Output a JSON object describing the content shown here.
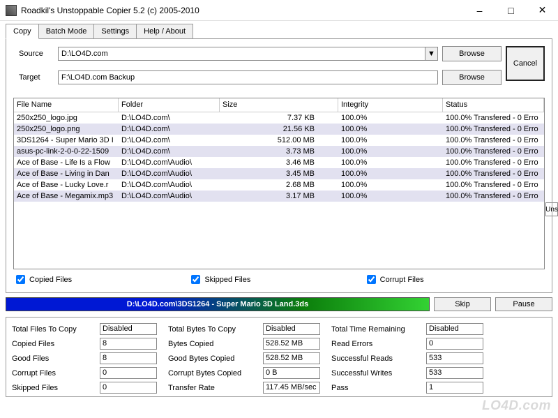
{
  "window": {
    "title": "Roadkil's Unstoppable Copier 5.2 (c) 2005-2010"
  },
  "tabs": [
    "Copy",
    "Batch Mode",
    "Settings",
    "Help / About"
  ],
  "active_tab": 0,
  "paths": {
    "source_label": "Source",
    "source_value": "D:\\LO4D.com",
    "target_label": "Target",
    "target_value": "F:\\LO4D.com Backup",
    "browse_label": "Browse",
    "cancel_label": "Cancel"
  },
  "columns": {
    "file_name": "File Name",
    "folder": "Folder",
    "size": "Size",
    "integrity": "Integrity",
    "status": "Status"
  },
  "rows": [
    {
      "name": "250x250_logo.jpg",
      "folder": "D:\\LO4D.com\\",
      "size": "7.37 KB",
      "integ": "100.0%",
      "status": "100.0% Transfered - 0 Erro",
      "sel": false
    },
    {
      "name": "250x250_logo.png",
      "folder": "D:\\LO4D.com\\",
      "size": "21.56 KB",
      "integ": "100.0%",
      "status": "100.0% Transfered - 0 Erro",
      "sel": true
    },
    {
      "name": "3DS1264 - Super Mario 3D I",
      "folder": "D:\\LO4D.com\\",
      "size": "512.00 MB",
      "integ": "100.0%",
      "status": "100.0% Transfered - 0 Erro",
      "sel": false
    },
    {
      "name": "asus-pc-link-2-0-0-22-1509",
      "folder": "D:\\LO4D.com\\",
      "size": "3.73 MB",
      "integ": "100.0%",
      "status": "100.0% Transfered - 0 Erro",
      "sel": true
    },
    {
      "name": "Ace of Base - Life Is a Flow",
      "folder": "D:\\LO4D.com\\Audio\\",
      "size": "3.46 MB",
      "integ": "100.0%",
      "status": "100.0% Transfered - 0 Erro",
      "sel": false
    },
    {
      "name": "Ace of Base - Living in Dan",
      "folder": "D:\\LO4D.com\\Audio\\",
      "size": "3.45 MB",
      "integ": "100.0%",
      "status": "100.0% Transfered - 0 Erro",
      "sel": true
    },
    {
      "name": "Ace of Base - Lucky Love.r",
      "folder": "D:\\LO4D.com\\Audio\\",
      "size": "2.68 MB",
      "integ": "100.0%",
      "status": "100.0% Transfered - 0 Erro",
      "sel": false
    },
    {
      "name": "Ace of Base - Megamix.mp3",
      "folder": "D:\\LO4D.com\\Audio\\",
      "size": "3.17 MB",
      "integ": "100.0%",
      "status": "100.0% Transfered - 0 Erro",
      "sel": true
    }
  ],
  "checks": {
    "copied": "Copied Files",
    "skipped": "Skipped Files",
    "corrupt": "Corrupt Files"
  },
  "progress": {
    "text": "D:\\LO4D.com\\3DS1264 - Super Mario 3D Land.3ds",
    "skip": "Skip",
    "pause": "Pause"
  },
  "stats": {
    "total_files_to_copy": {
      "label": "Total Files To Copy",
      "value": "Disabled"
    },
    "copied_files": {
      "label": "Copied Files",
      "value": "8"
    },
    "good_files": {
      "label": "Good Files",
      "value": "8"
    },
    "corrupt_files": {
      "label": "Corrupt Files",
      "value": "0"
    },
    "skipped_files": {
      "label": "Skipped Files",
      "value": "0"
    },
    "total_bytes_to_copy": {
      "label": "Total Bytes To Copy",
      "value": "Disabled"
    },
    "bytes_copied": {
      "label": "Bytes Copied",
      "value": "528.52 MB"
    },
    "good_bytes_copied": {
      "label": "Good Bytes Copied",
      "value": "528.52 MB"
    },
    "corrupt_bytes_copied": {
      "label": "Corrupt Bytes Copied",
      "value": "0 B"
    },
    "transfer_rate": {
      "label": "Transfer Rate",
      "value": "117.45 MB/sec"
    },
    "total_time_remaining": {
      "label": "Total Time Remaining",
      "value": "Disabled"
    },
    "read_errors": {
      "label": "Read Errors",
      "value": "0"
    },
    "successful_reads": {
      "label": "Successful Reads",
      "value": "533"
    },
    "successful_writes": {
      "label": "Successful Writes",
      "value": "533"
    },
    "pass": {
      "label": "Pass",
      "value": "1"
    }
  },
  "watermark": "LO4D.com",
  "overflow_hint": "Uns"
}
